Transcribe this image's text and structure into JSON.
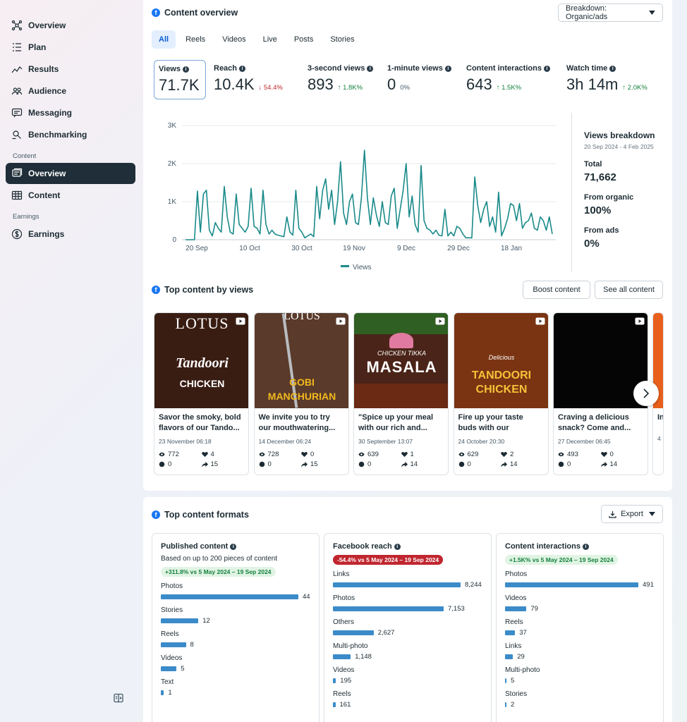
{
  "sidebar": {
    "items": [
      {
        "label": "Overview",
        "icon": "network-icon"
      },
      {
        "label": "Plan",
        "icon": "list-icon"
      },
      {
        "label": "Results",
        "icon": "trend-icon"
      },
      {
        "label": "Audience",
        "icon": "people-icon"
      },
      {
        "label": "Messaging",
        "icon": "message-icon"
      },
      {
        "label": "Benchmarking",
        "icon": "benchmark-icon"
      }
    ],
    "section_content": "Content",
    "content_items": [
      {
        "label": "Overview",
        "icon": "content-overview-icon",
        "active": true
      },
      {
        "label": "Content",
        "icon": "table-icon"
      }
    ],
    "section_earnings": "Earnings",
    "earnings_items": [
      {
        "label": "Earnings",
        "icon": "dollar-icon"
      }
    ]
  },
  "overview": {
    "title": "Content overview",
    "breakdown_dropdown": "Breakdown: Organic/ads",
    "tabs": [
      "All",
      "Reels",
      "Videos",
      "Live",
      "Posts",
      "Stories"
    ],
    "metrics": [
      {
        "label": "Views",
        "value": "71.7K",
        "change": "",
        "dir": ""
      },
      {
        "label": "Reach",
        "value": "10.4K",
        "change": "54.4%",
        "dir": "down"
      },
      {
        "label": "3-second views",
        "value": "893",
        "change": "1.8K%",
        "dir": "up"
      },
      {
        "label": "1-minute views",
        "value": "0",
        "change": "0%",
        "dir": "flat"
      },
      {
        "label": "Content interactions",
        "value": "643",
        "change": "1.5K%",
        "dir": "up"
      },
      {
        "label": "Watch time",
        "value": "3h 14m",
        "change": "2.0K%",
        "dir": "up"
      }
    ],
    "breakdown": {
      "title": "Views breakdown",
      "date": "20 Sep 2024 - 4 Feb 2025",
      "total_label": "Total",
      "total_value": "71,662",
      "organic_label": "From organic",
      "organic_value": "100%",
      "ads_label": "From ads",
      "ads_value": "0%"
    }
  },
  "chart_data": {
    "type": "line",
    "x_ticks": [
      "20 Sep",
      "10 Oct",
      "30 Oct",
      "19 Nov",
      "9 Dec",
      "29 Dec",
      "18 Jan"
    ],
    "y_ticks": [
      "0",
      "1K",
      "2K",
      "3K"
    ],
    "ylim": [
      0,
      3000
    ],
    "legend": "Views",
    "series": [
      {
        "name": "Views",
        "color": "#1a8a8a",
        "values": [
          0,
          0,
          0,
          0,
          1280,
          200,
          1200,
          1300,
          250,
          100,
          450,
          300,
          200,
          1400,
          600,
          200,
          150,
          1200,
          400,
          300,
          200,
          350,
          1350,
          350,
          300,
          150,
          1300,
          400,
          150,
          250,
          150,
          120,
          100,
          80,
          600,
          200,
          120,
          1300,
          300,
          200,
          50,
          100,
          150,
          80,
          1400,
          550,
          1300,
          1600,
          800,
          1300,
          400,
          1000,
          2050,
          700,
          400,
          1000,
          1200,
          450,
          400,
          1100,
          2350,
          1100,
          400,
          1100,
          650,
          350,
          1000,
          450,
          400,
          1150,
          1350,
          300,
          800,
          1300,
          2000,
          600,
          1150,
          400,
          200,
          1950,
          500,
          300,
          250,
          150,
          250,
          120,
          100,
          800,
          100,
          200,
          100,
          350,
          300,
          150,
          50,
          50,
          50,
          1650,
          900,
          450,
          800,
          1000,
          350,
          600,
          200,
          1250,
          100,
          300,
          550,
          950,
          900,
          500,
          950,
          300,
          450,
          500,
          700,
          300,
          250,
          600,
          500,
          250,
          600,
          150
        ]
      }
    ]
  },
  "top_content": {
    "title": "Top content by views",
    "boost_label": "Boost content",
    "see_all_label": "See all content",
    "posts": [
      {
        "thumb": "lotus",
        "caption": "Savor the smoky, bold flavors of our Tando...",
        "date": "23 November 06:18",
        "views": "772",
        "likes": "4",
        "comments": "0",
        "shares": "15",
        "bg": "#3a1d12",
        "t1": "LOTUS",
        "t2": "Tandoori",
        "t3": "CHICKEN"
      },
      {
        "thumb": "manchurian",
        "caption": "We invite you to try our mouthwatering...",
        "date": "14 December 06:24",
        "views": "728",
        "likes": "0",
        "comments": "0",
        "shares": "15",
        "bg": "#5a3a2a",
        "t1": "LOTUS",
        "t2": "GOBI",
        "t3": "MANCHURIAN"
      },
      {
        "thumb": "masala",
        "caption": "\"Spice up your meal with our rich and...",
        "date": "30 September 13:07",
        "views": "639",
        "likes": "1",
        "comments": "0",
        "shares": "14",
        "bg": "#4a2418",
        "t1": "CHICKEN TIKKA",
        "t2": "MASALA",
        "t3": ""
      },
      {
        "thumb": "fireup",
        "caption": "Fire up your taste buds with our Tandoori...",
        "date": "24 October 20:30",
        "views": "629",
        "likes": "2",
        "comments": "0",
        "shares": "14",
        "bg": "#7a3412",
        "t1": "Delicious",
        "t2": "TANDOORI",
        "t3": "CHICKEN"
      },
      {
        "thumb": "black",
        "caption": "Craving a delicious snack? Come and...",
        "date": "27 December 06:45",
        "views": "493",
        "likes": "0",
        "comments": "0",
        "shares": "14",
        "bg": "#050505",
        "t1": "",
        "t2": "",
        "t3": ""
      }
    ],
    "partial": {
      "caption": "In",
      "date": "4",
      "views": "",
      "bg": "#e8601c"
    }
  },
  "formats": {
    "title": "Top content formats",
    "export_label": "Export",
    "published": {
      "title": "Published content",
      "sub": "Based on up to 200 pieces of content",
      "pill": "+311.8% vs 5 May 2024 – 19 Sep 2024",
      "rows": [
        {
          "label": "Photos",
          "value": "44",
          "n": 44
        },
        {
          "label": "Stories",
          "value": "12",
          "n": 12
        },
        {
          "label": "Reels",
          "value": "8",
          "n": 8
        },
        {
          "label": "Videos",
          "value": "5",
          "n": 5
        },
        {
          "label": "Text",
          "value": "1",
          "n": 1
        }
      ],
      "max": 44
    },
    "reach": {
      "title": "Facebook reach",
      "pill": "-54.4% vs 5 May 2024 – 19 Sep 2024",
      "rows": [
        {
          "label": "Links",
          "value": "8,244",
          "n": 8244
        },
        {
          "label": "Photos",
          "value": "7,153",
          "n": 7153
        },
        {
          "label": "Others",
          "value": "2,627",
          "n": 2627
        },
        {
          "label": "Multi-photo",
          "value": "1,148",
          "n": 1148
        },
        {
          "label": "Videos",
          "value": "195",
          "n": 195
        },
        {
          "label": "Reels",
          "value": "161",
          "n": 161
        }
      ],
      "max": 8244
    },
    "interactions": {
      "title": "Content interactions",
      "pill": "+1.5K% vs 5 May 2024 – 19 Sep 2024",
      "rows": [
        {
          "label": "Photos",
          "value": "491",
          "n": 491
        },
        {
          "label": "Videos",
          "value": "79",
          "n": 79
        },
        {
          "label": "Reels",
          "value": "37",
          "n": 37
        },
        {
          "label": "Links",
          "value": "29",
          "n": 29
        },
        {
          "label": "Multi-photo",
          "value": "5",
          "n": 5
        },
        {
          "label": "Stories",
          "value": "2",
          "n": 2
        }
      ],
      "max": 491
    }
  }
}
